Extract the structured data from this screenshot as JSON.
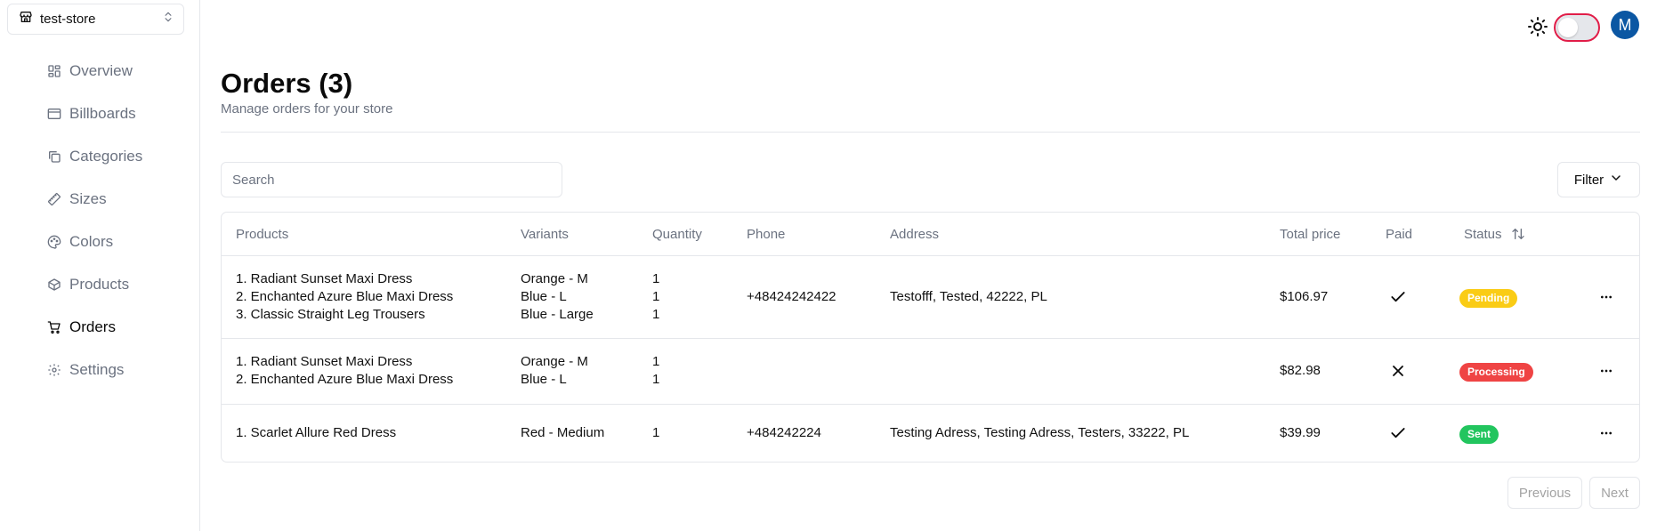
{
  "store": {
    "name": "test-store"
  },
  "nav": [
    {
      "label": "Overview",
      "icon": "overview-icon"
    },
    {
      "label": "Billboards",
      "icon": "billboard-icon"
    },
    {
      "label": "Categories",
      "icon": "categories-icon"
    },
    {
      "label": "Sizes",
      "icon": "ruler-icon"
    },
    {
      "label": "Colors",
      "icon": "palette-icon"
    },
    {
      "label": "Products",
      "icon": "box-icon"
    },
    {
      "label": "Orders",
      "icon": "cart-icon",
      "active": true
    },
    {
      "label": "Settings",
      "icon": "gear-icon"
    }
  ],
  "header": {
    "avatar_letter": "M",
    "accent": "#e11d48",
    "avatar_color": "#0b57a3"
  },
  "page": {
    "title": "Orders (3)",
    "subtitle": "Manage orders for your store"
  },
  "search": {
    "placeholder": "Search",
    "value": ""
  },
  "filter": {
    "label": "Filter"
  },
  "table": {
    "columns": [
      "Products",
      "Variants",
      "Quantity",
      "Phone",
      "Address",
      "Total price",
      "Paid",
      "Status"
    ],
    "rows": [
      {
        "products": [
          "1. Radiant Sunset Maxi Dress",
          "2. Enchanted Azure Blue Maxi Dress",
          "3. Classic Straight Leg Trousers"
        ],
        "variants": [
          "Orange - M",
          "Blue - L",
          "Blue - Large"
        ],
        "quantities": [
          "1",
          "1",
          "1"
        ],
        "phone": "+48424242422",
        "address": "Testofff, Tested, 42222, PL",
        "total": "$106.97",
        "paid": true,
        "status": "Pending",
        "status_color": "#facc15"
      },
      {
        "products": [
          "1. Radiant Sunset Maxi Dress",
          "2. Enchanted Azure Blue Maxi Dress"
        ],
        "variants": [
          "Orange - M",
          "Blue - L"
        ],
        "quantities": [
          "1",
          "1"
        ],
        "phone": "",
        "address": "",
        "total": "$82.98",
        "paid": false,
        "status": "Processing",
        "status_color": "#ef4444"
      },
      {
        "products": [
          "1. Scarlet Allure Red Dress"
        ],
        "variants": [
          "Red - Medium"
        ],
        "quantities": [
          "1"
        ],
        "phone": "+484242224",
        "address": "Testing Adress, Testing Adress, Testers, 33222, PL",
        "total": "$39.99",
        "paid": true,
        "status": "Sent",
        "status_color": "#22c55e"
      }
    ]
  },
  "pagination": {
    "previous": "Previous",
    "next": "Next"
  }
}
